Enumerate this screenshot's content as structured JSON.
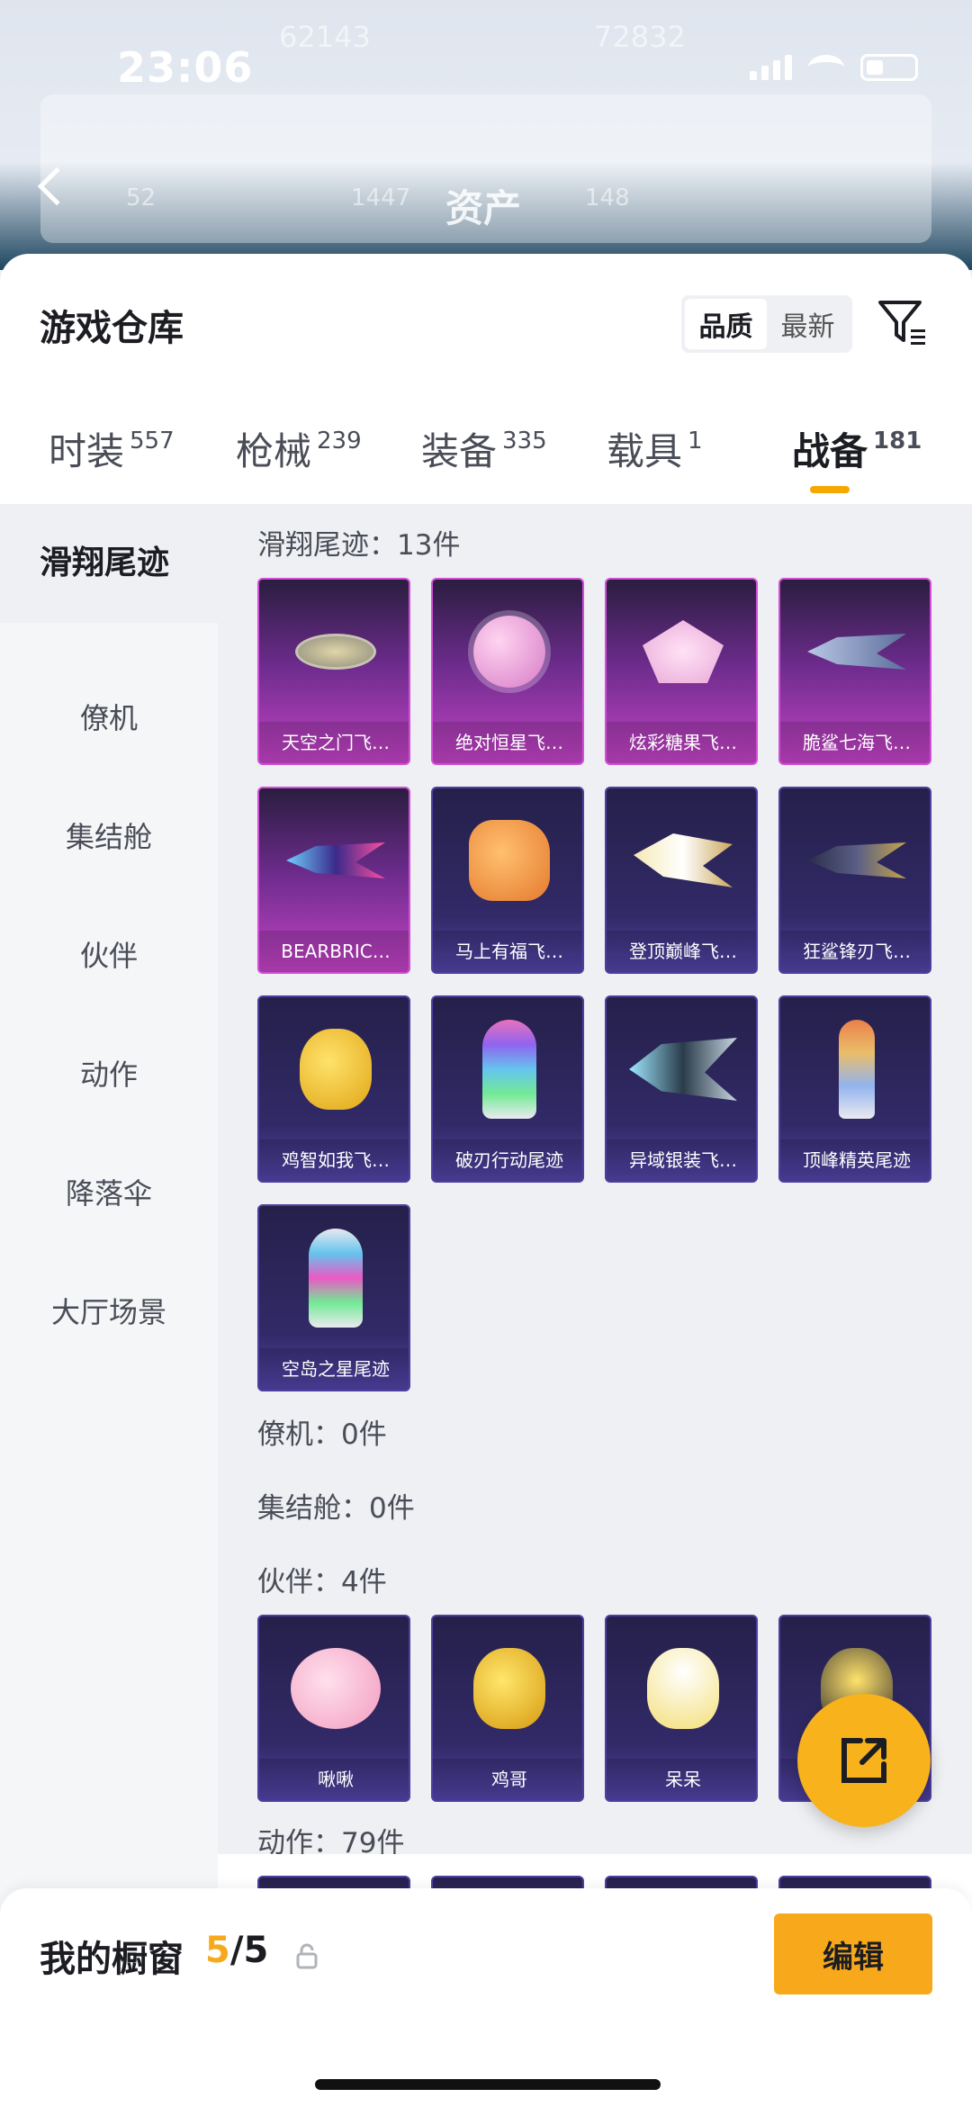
{
  "status": {
    "time": "23:06"
  },
  "header_bg": {
    "title": "资产",
    "faint_values": [
      "62143",
      "72832",
      "52",
      "1447",
      "148"
    ]
  },
  "sheet": {
    "title": "游戏仓库",
    "sort_options": [
      "品质",
      "最新"
    ],
    "tabs": [
      {
        "label": "时装",
        "count": "557"
      },
      {
        "label": "枪械",
        "count": "239"
      },
      {
        "label": "装备",
        "count": "335"
      },
      {
        "label": "载具",
        "count": "1"
      },
      {
        "label": "战备",
        "count": "181"
      }
    ]
  },
  "side_menu": [
    "滑翔尾迹",
    "僚机",
    "集结舱",
    "伙伴",
    "动作",
    "降落伞",
    "大厅场景"
  ],
  "sections": {
    "glide": {
      "header": "滑翔尾迹：13件",
      "items": [
        "天空之门飞…",
        "绝对恒星飞…",
        "炫彩糖果飞…",
        "脆鲨七海飞…",
        "BEARBRIC…",
        "马上有福飞…",
        "登顶巅峰飞…",
        "狂鲨锋刃飞…",
        "鸡智如我飞…",
        "破刃行动尾迹",
        "异域银装飞…",
        "顶峰精英尾迹",
        "空岛之星尾迹"
      ]
    },
    "wingman": {
      "header": "僚机：0件"
    },
    "pod": {
      "header": "集结舱：0件"
    },
    "partner": {
      "header": "伙伴：4件",
      "items": [
        "啾啾",
        "鸡哥",
        "呆呆",
        ""
      ]
    },
    "emote": {
      "header": "动作：79件"
    }
  },
  "bottom": {
    "label": "我的橱窗",
    "count_current": "5",
    "count_sep": "/5",
    "edit_label": "编辑"
  },
  "colors": {
    "accent": "#f7a81b",
    "card_pink": "#c443c6",
    "card_purple": "#322a68"
  }
}
